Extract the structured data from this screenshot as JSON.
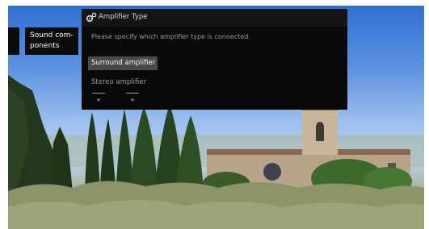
{
  "side_panel": {
    "label": "Sound com-\nponents"
  },
  "dialog": {
    "title": "Amplifier Type",
    "icon": "gear-icon",
    "instruction": "Please specify which amplifier type is connected.",
    "options": [
      {
        "label": "Surround amplifier",
        "selected": true
      },
      {
        "label": "Stereo amplifier",
        "selected": false
      }
    ],
    "nav": {
      "back_icon": "double-left-arrow-icon",
      "forward_icon": "double-right-arrow-icon",
      "back_glyph": "«",
      "forward_glyph": "»"
    }
  },
  "colors": {
    "dialog_bg": "#0a0a0a",
    "header_bg": "#151515",
    "selected_bg": "#4a4a4a"
  }
}
